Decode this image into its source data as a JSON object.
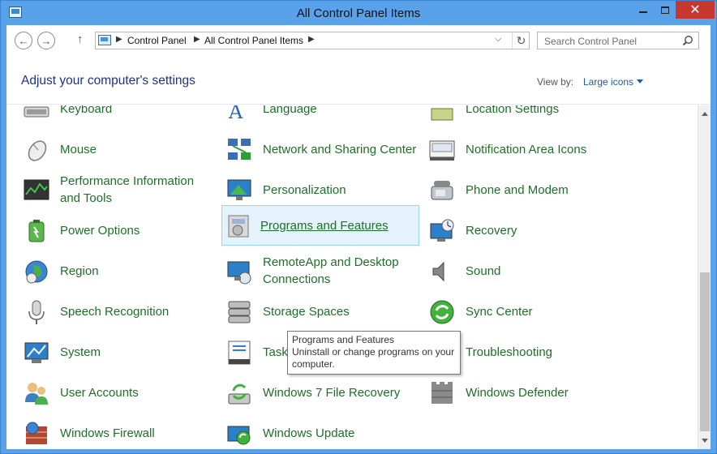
{
  "window": {
    "title": "All Control Panel Items"
  },
  "address": {
    "crumbs": [
      "Control Panel",
      "All Control Panel Items"
    ]
  },
  "search": {
    "placeholder": "Search Control Panel"
  },
  "header": {
    "title": "Adjust your computer's settings",
    "view_by_label": "View by:",
    "view_by_value": "Large icons"
  },
  "items": {
    "keyboard": "Keyboard",
    "language": "Language",
    "location_settings": "Location Settings",
    "mouse": "Mouse",
    "network_sharing": "Network and Sharing Center",
    "notification_area_icons": "Notification Area Icons",
    "performance": "Performance Information and Tools",
    "personalization": "Personalization",
    "phone_modem": "Phone and Modem",
    "power_options": "Power Options",
    "programs_features": "Programs and Features",
    "recovery": "Recovery",
    "region": "Region",
    "remoteapp": "RemoteApp and Desktop Connections",
    "sound": "Sound",
    "speech_recognition": "Speech Recognition",
    "storage_spaces": "Storage Spaces",
    "sync_center": "Sync Center",
    "system": "System",
    "taskbar": "Taskbar",
    "troubleshooting": "Troubleshooting",
    "user_accounts": "User Accounts",
    "win7_file_recovery": "Windows 7 File Recovery",
    "windows_defender": "Windows Defender",
    "windows_firewall": "Windows Firewall",
    "windows_update": "Windows Update"
  },
  "tooltip": {
    "title": "Programs and Features",
    "description": "Uninstall or change programs on your computer."
  },
  "colors": {
    "link_green": "#1f6e29",
    "heading_blue": "#1e3287",
    "titlebar_blue": "#59a1e8",
    "close_red": "#c7372f"
  }
}
